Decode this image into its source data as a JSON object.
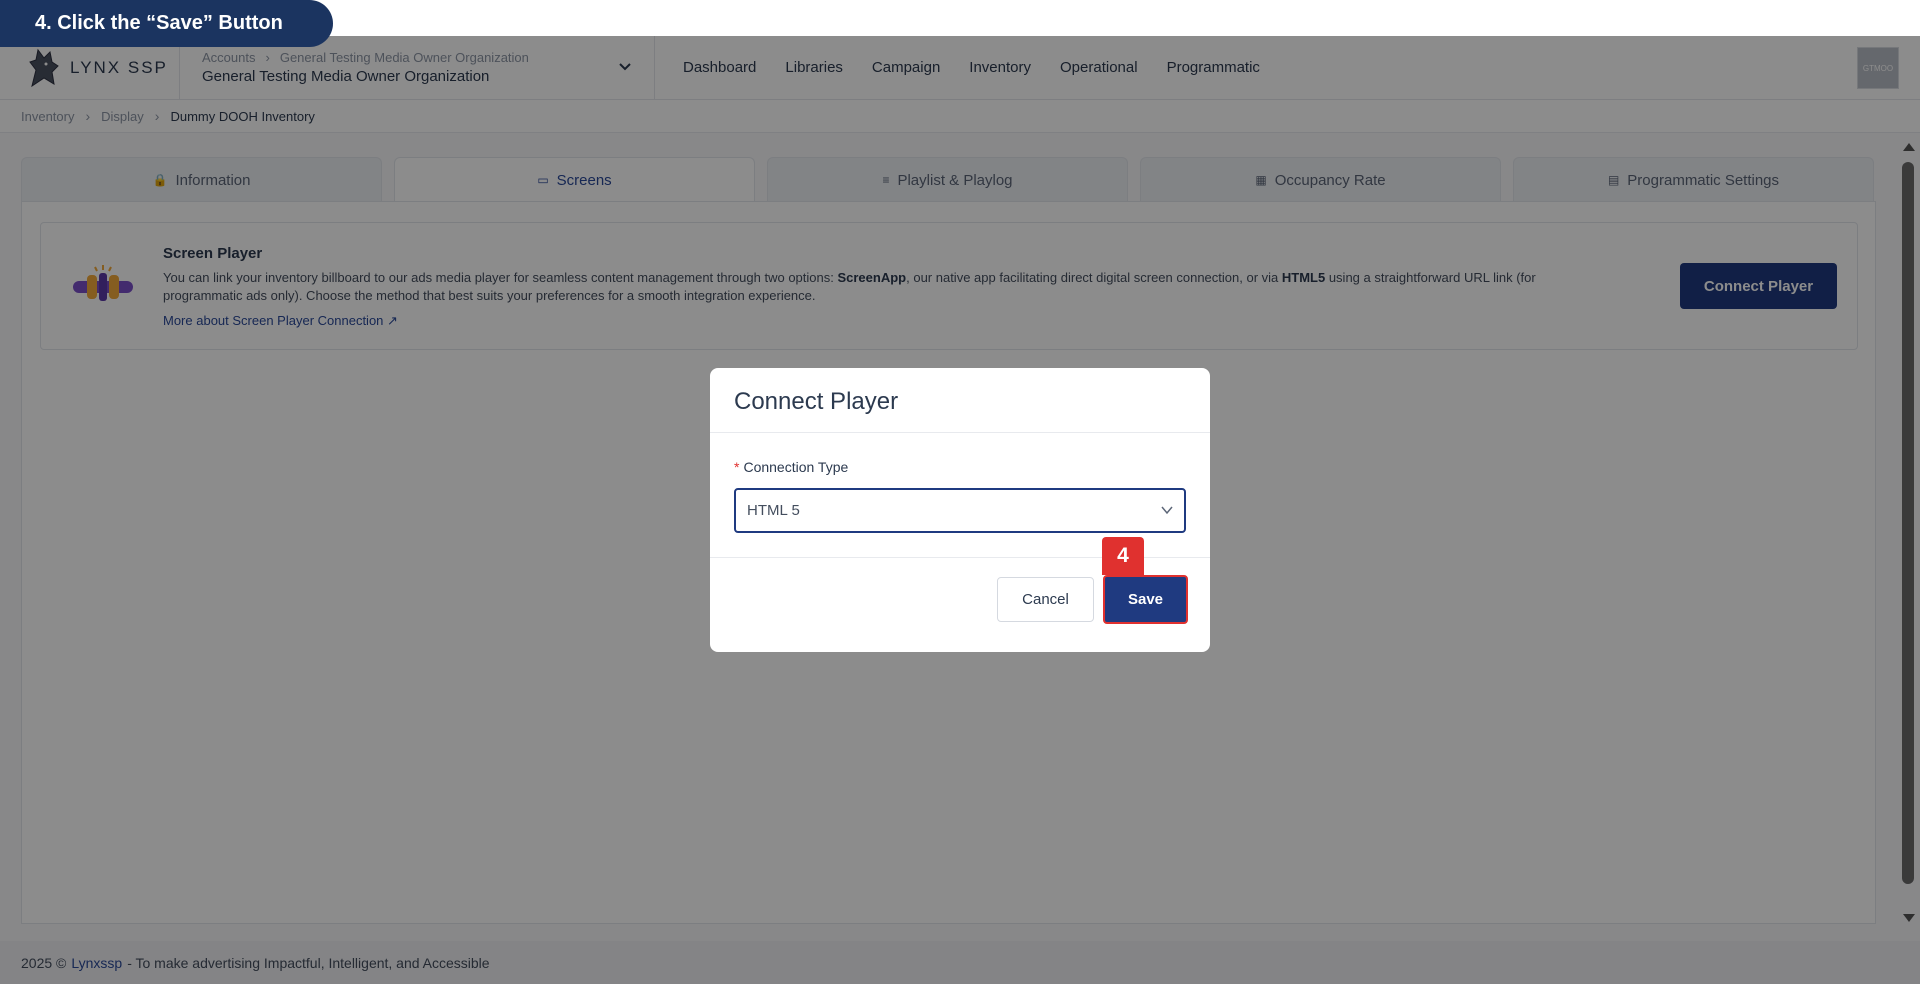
{
  "instruction": {
    "step_label": "4. Click the “Save” Button",
    "badge_number": "4"
  },
  "header": {
    "logo_text": "LYNX SSP",
    "org_crumb": [
      "Accounts",
      "General Testing Media Owner Organization"
    ],
    "org_name": "General Testing Media Owner Organization",
    "nav": [
      "Dashboard",
      "Libraries",
      "Campaign",
      "Inventory",
      "Operational",
      "Programmatic"
    ],
    "avatar_text": "GTMOO"
  },
  "breadcrumb": {
    "items": [
      "Inventory",
      "Display"
    ],
    "current": "Dummy DOOH Inventory"
  },
  "tabs": [
    {
      "label": "Information",
      "icon": "lock-icon"
    },
    {
      "label": "Screens",
      "icon": "monitor-icon",
      "active": true
    },
    {
      "label": "Playlist & Playlog",
      "icon": "list-icon"
    },
    {
      "label": "Occupancy Rate",
      "icon": "chart-icon"
    },
    {
      "label": "Programmatic Settings",
      "icon": "server-icon"
    }
  ],
  "screen_player": {
    "title": "Screen Player",
    "desc_a": "You can link your inventory billboard to our ads media player for seamless content management through two options: ",
    "desc_b": "ScreenApp",
    "desc_c": ", our native app facilitating direct digital screen connection, or via ",
    "desc_d": "HTML5",
    "desc_e": " using a straightforward URL link (for programmatic ads only). Choose the method that best suits your preferences for a smooth integration experience.",
    "link": "More about Screen Player Connection ↗",
    "button": "Connect Player"
  },
  "modal": {
    "title": "Connect Player",
    "field_label": "Connection Type",
    "required_mark": "*",
    "select_value": "HTML 5",
    "cancel": "Cancel",
    "save": "Save"
  },
  "footer": {
    "prefix": "2025 ©",
    "link": "Lynxssp",
    "suffix": "- To make advertising Impactful, Intelligent, and Accessible"
  },
  "colors": {
    "primary": "#1f3a80",
    "accent_red": "#e0312f",
    "pill_navy": "#1b3460"
  }
}
